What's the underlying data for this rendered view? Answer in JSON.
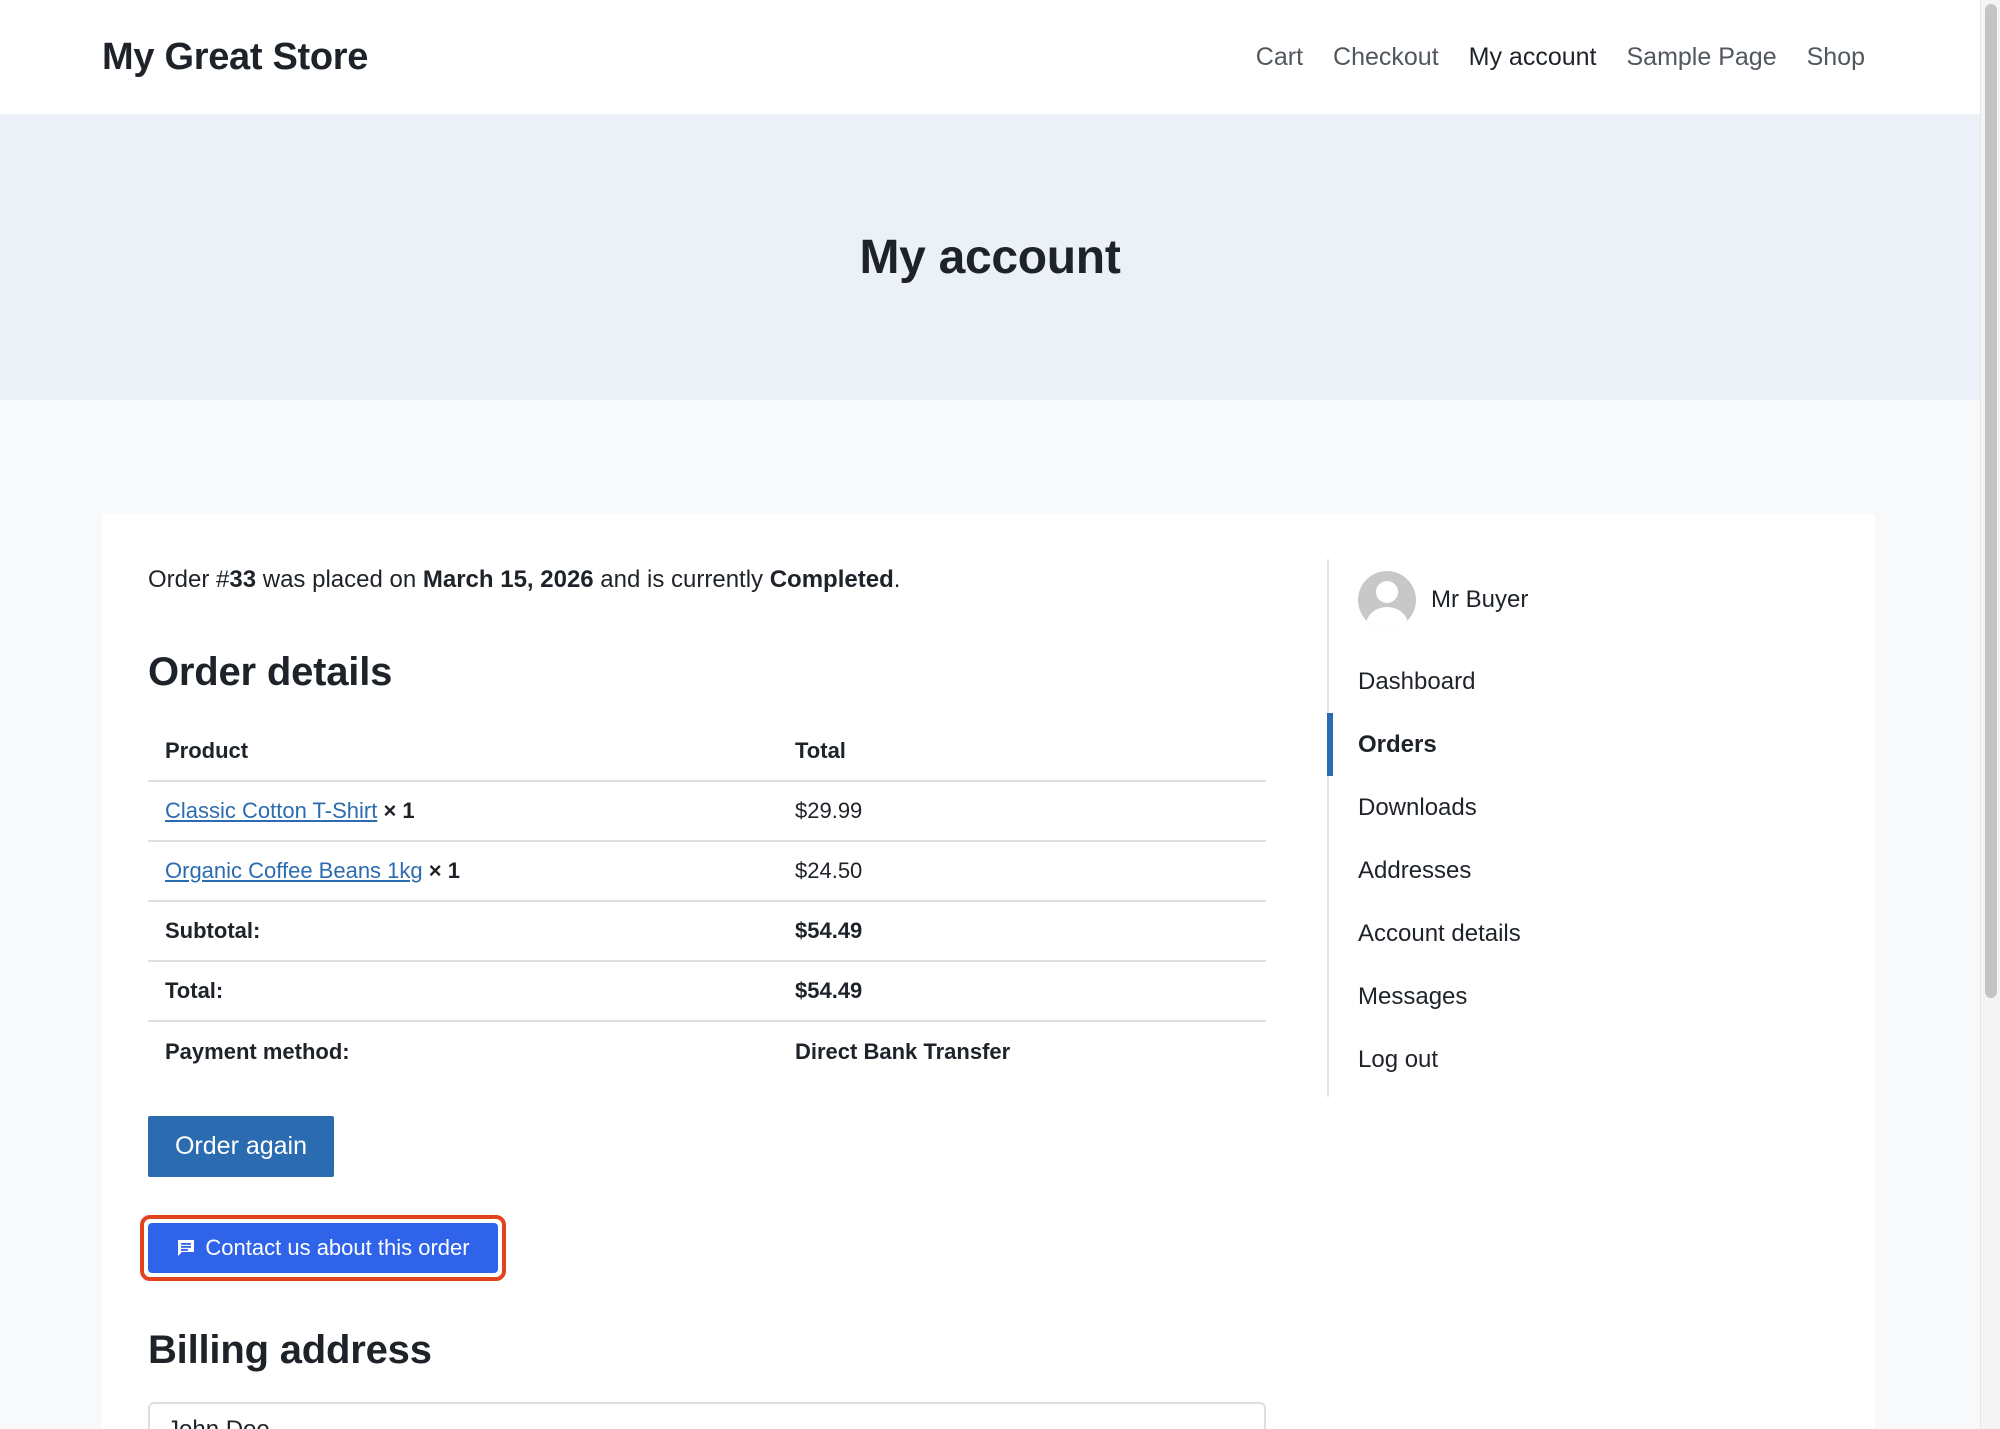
{
  "site": {
    "title": "My Great Store",
    "nav": [
      "Cart",
      "Checkout",
      "My account",
      "Sample Page",
      "Shop"
    ],
    "current_nav": "My account"
  },
  "hero": {
    "title": "My account"
  },
  "order": {
    "intro_prefix": "Order #",
    "number": "33",
    "intro_mid": " was placed on ",
    "date": "March 15, 2026",
    "intro_mid2": " and is currently ",
    "status": "Completed",
    "intro_end": "."
  },
  "order_details": {
    "title": "Order details",
    "headers": {
      "product": "Product",
      "total": "Total"
    },
    "items": [
      {
        "name": "Classic Cotton T-Shirt",
        "qty": "× 1",
        "total": "$29.99"
      },
      {
        "name": "Organic Coffee Beans 1kg",
        "qty": "× 1",
        "total": "$24.50"
      }
    ],
    "summary": [
      {
        "label": "Subtotal:",
        "value": "$54.49"
      },
      {
        "label": "Total:",
        "value": "$54.49"
      },
      {
        "label": "Payment method:",
        "value": "Direct Bank Transfer"
      }
    ]
  },
  "buttons": {
    "order_again": "Order again",
    "contact": "Contact us about this order"
  },
  "billing": {
    "title": "Billing address",
    "name": "John Doe"
  },
  "account_nav": {
    "user_name": "Mr Buyer",
    "items": [
      "Dashboard",
      "Orders",
      "Downloads",
      "Addresses",
      "Account details",
      "Messages",
      "Log out"
    ],
    "active": "Orders"
  },
  "colors": {
    "accent": "#2b6cb0",
    "contact_button": "#2f63e9",
    "highlight_border": "#e3431c",
    "hero_bg": "#ecf1f8"
  },
  "icons": {
    "contact_button_icon": "chat-bubble-icon",
    "avatar": "user-placeholder-avatar"
  }
}
